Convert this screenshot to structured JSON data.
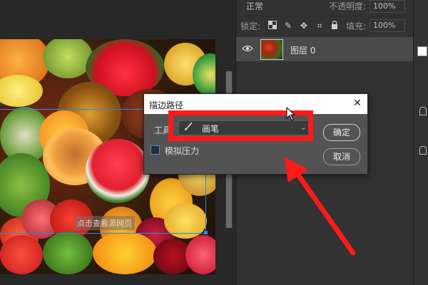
{
  "layers_panel": {
    "blend_mode": "正常",
    "opacity_label": "不透明度:",
    "opacity_value": "100%",
    "lock_label": "锁定:",
    "fill_label": "填充:",
    "fill_value": "100%",
    "layer_name": "图层 0",
    "icons": [
      "checkerboard-lock-icon",
      "brush-lock-icon",
      "move-lock-icon",
      "artboard-lock-icon",
      "padlock-icon",
      "eye-icon"
    ]
  },
  "canvas": {
    "watermark": "点击查看源网页"
  },
  "dialog": {
    "title": "描边路径",
    "tool_label": "工具:",
    "tool_value": "画笔",
    "pressure_label": "模拟压力",
    "pressure_checked": false,
    "ok_label": "确定",
    "cancel_label": "取消"
  },
  "colors": {
    "annotation_red": "#ff1a1a",
    "path_blue": "#2a8ad8",
    "panel_bg": "#323232"
  }
}
